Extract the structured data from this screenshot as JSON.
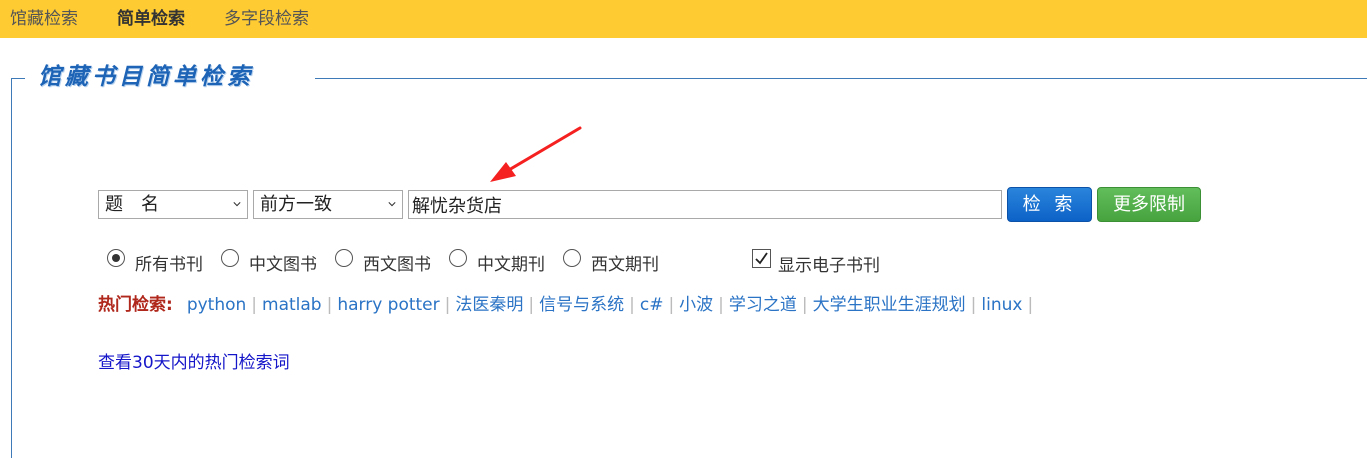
{
  "nav": {
    "tabs": [
      {
        "label": "馆藏检索"
      },
      {
        "label": "简单检索"
      },
      {
        "label": "多字段检索"
      }
    ]
  },
  "panel": {
    "title": "馆藏书目简单检索"
  },
  "search": {
    "field_select": "题　名",
    "match_select": "前方一致",
    "query": "解忧杂货店",
    "search_button": "检 索",
    "more_button": "更多限制"
  },
  "filters": {
    "doc_types": [
      {
        "label": "所有书刊",
        "checked": true
      },
      {
        "label": "中文图书",
        "checked": false
      },
      {
        "label": "西文图书",
        "checked": false
      },
      {
        "label": "中文期刊",
        "checked": false
      },
      {
        "label": "西文期刊",
        "checked": false
      }
    ],
    "show_ebooks": {
      "label": "显示电子书刊",
      "checked": true
    }
  },
  "hot": {
    "label": "热门检索:",
    "terms": [
      "python",
      "matlab",
      "harry potter",
      "法医秦明",
      "信号与系统",
      "c#",
      "小波",
      "学习之道",
      "大学生职业生涯规划",
      "linux"
    ],
    "separator": "|"
  },
  "recent_link": "查看30天内的热门检索词",
  "colors": {
    "nav_bg": "#fecb33",
    "accent_blue": "#1e64b6",
    "search_button": "#0d62c7",
    "more_button": "#46a33e",
    "hot_label": "#b0271c",
    "annotation_arrow": "#f52020"
  }
}
